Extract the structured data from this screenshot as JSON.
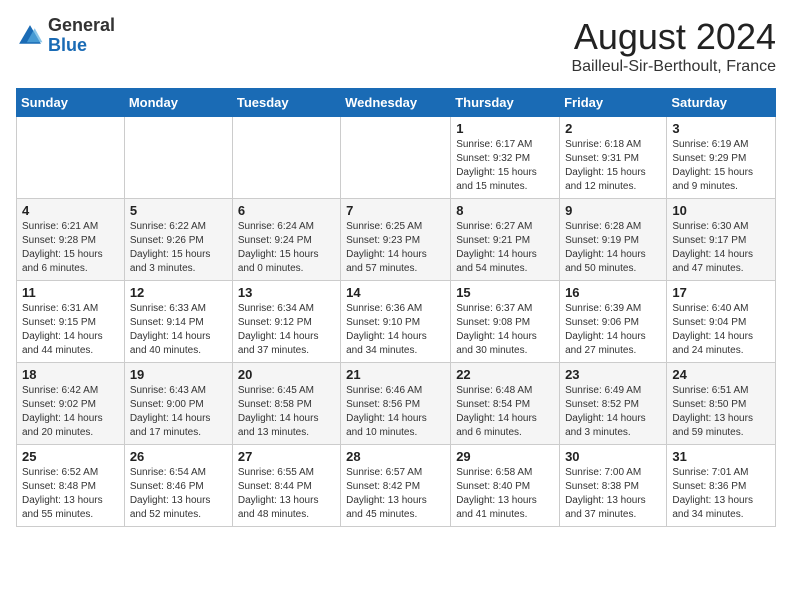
{
  "header": {
    "logo_general": "General",
    "logo_blue": "Blue",
    "title": "August 2024",
    "subtitle": "Bailleul-Sir-Berthoult, France"
  },
  "weekdays": [
    "Sunday",
    "Monday",
    "Tuesday",
    "Wednesday",
    "Thursday",
    "Friday",
    "Saturday"
  ],
  "weeks": [
    [
      {
        "day": "",
        "info": ""
      },
      {
        "day": "",
        "info": ""
      },
      {
        "day": "",
        "info": ""
      },
      {
        "day": "",
        "info": ""
      },
      {
        "day": "1",
        "info": "Sunrise: 6:17 AM\nSunset: 9:32 PM\nDaylight: 15 hours\nand 15 minutes."
      },
      {
        "day": "2",
        "info": "Sunrise: 6:18 AM\nSunset: 9:31 PM\nDaylight: 15 hours\nand 12 minutes."
      },
      {
        "day": "3",
        "info": "Sunrise: 6:19 AM\nSunset: 9:29 PM\nDaylight: 15 hours\nand 9 minutes."
      }
    ],
    [
      {
        "day": "4",
        "info": "Sunrise: 6:21 AM\nSunset: 9:28 PM\nDaylight: 15 hours\nand 6 minutes."
      },
      {
        "day": "5",
        "info": "Sunrise: 6:22 AM\nSunset: 9:26 PM\nDaylight: 15 hours\nand 3 minutes."
      },
      {
        "day": "6",
        "info": "Sunrise: 6:24 AM\nSunset: 9:24 PM\nDaylight: 15 hours\nand 0 minutes."
      },
      {
        "day": "7",
        "info": "Sunrise: 6:25 AM\nSunset: 9:23 PM\nDaylight: 14 hours\nand 57 minutes."
      },
      {
        "day": "8",
        "info": "Sunrise: 6:27 AM\nSunset: 9:21 PM\nDaylight: 14 hours\nand 54 minutes."
      },
      {
        "day": "9",
        "info": "Sunrise: 6:28 AM\nSunset: 9:19 PM\nDaylight: 14 hours\nand 50 minutes."
      },
      {
        "day": "10",
        "info": "Sunrise: 6:30 AM\nSunset: 9:17 PM\nDaylight: 14 hours\nand 47 minutes."
      }
    ],
    [
      {
        "day": "11",
        "info": "Sunrise: 6:31 AM\nSunset: 9:15 PM\nDaylight: 14 hours\nand 44 minutes."
      },
      {
        "day": "12",
        "info": "Sunrise: 6:33 AM\nSunset: 9:14 PM\nDaylight: 14 hours\nand 40 minutes."
      },
      {
        "day": "13",
        "info": "Sunrise: 6:34 AM\nSunset: 9:12 PM\nDaylight: 14 hours\nand 37 minutes."
      },
      {
        "day": "14",
        "info": "Sunrise: 6:36 AM\nSunset: 9:10 PM\nDaylight: 14 hours\nand 34 minutes."
      },
      {
        "day": "15",
        "info": "Sunrise: 6:37 AM\nSunset: 9:08 PM\nDaylight: 14 hours\nand 30 minutes."
      },
      {
        "day": "16",
        "info": "Sunrise: 6:39 AM\nSunset: 9:06 PM\nDaylight: 14 hours\nand 27 minutes."
      },
      {
        "day": "17",
        "info": "Sunrise: 6:40 AM\nSunset: 9:04 PM\nDaylight: 14 hours\nand 24 minutes."
      }
    ],
    [
      {
        "day": "18",
        "info": "Sunrise: 6:42 AM\nSunset: 9:02 PM\nDaylight: 14 hours\nand 20 minutes."
      },
      {
        "day": "19",
        "info": "Sunrise: 6:43 AM\nSunset: 9:00 PM\nDaylight: 14 hours\nand 17 minutes."
      },
      {
        "day": "20",
        "info": "Sunrise: 6:45 AM\nSunset: 8:58 PM\nDaylight: 14 hours\nand 13 minutes."
      },
      {
        "day": "21",
        "info": "Sunrise: 6:46 AM\nSunset: 8:56 PM\nDaylight: 14 hours\nand 10 minutes."
      },
      {
        "day": "22",
        "info": "Sunrise: 6:48 AM\nSunset: 8:54 PM\nDaylight: 14 hours\nand 6 minutes."
      },
      {
        "day": "23",
        "info": "Sunrise: 6:49 AM\nSunset: 8:52 PM\nDaylight: 14 hours\nand 3 minutes."
      },
      {
        "day": "24",
        "info": "Sunrise: 6:51 AM\nSunset: 8:50 PM\nDaylight: 13 hours\nand 59 minutes."
      }
    ],
    [
      {
        "day": "25",
        "info": "Sunrise: 6:52 AM\nSunset: 8:48 PM\nDaylight: 13 hours\nand 55 minutes."
      },
      {
        "day": "26",
        "info": "Sunrise: 6:54 AM\nSunset: 8:46 PM\nDaylight: 13 hours\nand 52 minutes."
      },
      {
        "day": "27",
        "info": "Sunrise: 6:55 AM\nSunset: 8:44 PM\nDaylight: 13 hours\nand 48 minutes."
      },
      {
        "day": "28",
        "info": "Sunrise: 6:57 AM\nSunset: 8:42 PM\nDaylight: 13 hours\nand 45 minutes."
      },
      {
        "day": "29",
        "info": "Sunrise: 6:58 AM\nSunset: 8:40 PM\nDaylight: 13 hours\nand 41 minutes."
      },
      {
        "day": "30",
        "info": "Sunrise: 7:00 AM\nSunset: 8:38 PM\nDaylight: 13 hours\nand 37 minutes."
      },
      {
        "day": "31",
        "info": "Sunrise: 7:01 AM\nSunset: 8:36 PM\nDaylight: 13 hours\nand 34 minutes."
      }
    ]
  ],
  "colors": {
    "header_bg": "#1a6bb5",
    "header_text": "#ffffff",
    "accent": "#1a6bb5"
  }
}
